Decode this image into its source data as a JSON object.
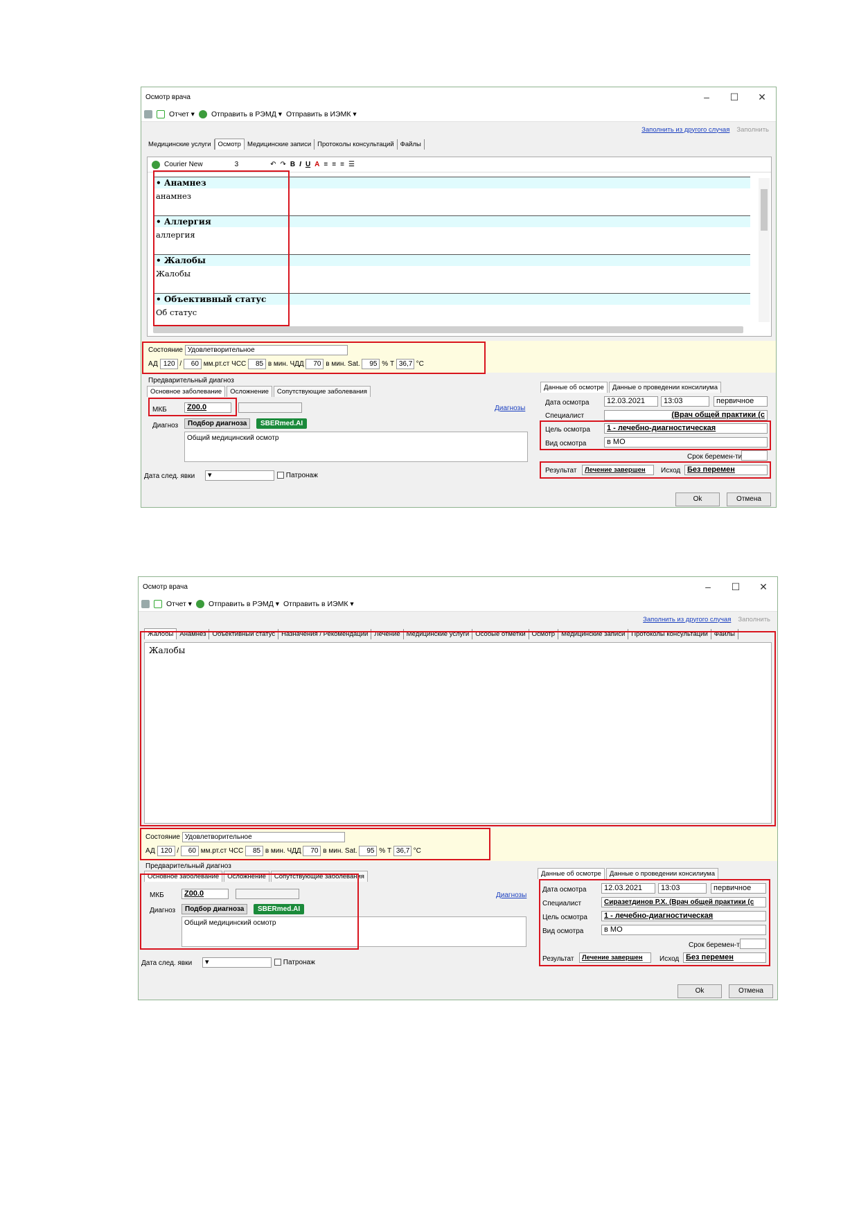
{
  "window1": {
    "title": "Осмотр врача",
    "toolbar": {
      "report": "Отчет ▾",
      "send_remd": "Отправить в РЭМД ▾",
      "send_iemk": "Отправить в ИЭМК ▾"
    },
    "fill_link": "Заполнить из другого случая",
    "fill_btn": "Заполнить",
    "tabs": [
      "Медицинские услуги",
      "Осмотр",
      "Медицинские записи",
      "Протоколы консультаций",
      "Файлы"
    ],
    "editor": {
      "font": "Courier New",
      "size": "3"
    },
    "sections": [
      {
        "title": "• Анамнез",
        "text": "анамнез"
      },
      {
        "title": "• Аллергия",
        "text": "аллергия"
      },
      {
        "title": "• Жалобы",
        "text": "Жалобы"
      },
      {
        "title": "• Объективный статус",
        "text": "Об статус"
      }
    ]
  },
  "window2": {
    "title": "Осмотр врача",
    "tabs": [
      "Жалобы",
      "Анамнез",
      "Объективный статус",
      "Назначения / Рекомендации",
      "Лечение",
      "Медицинские услуги",
      "Особые отметки",
      "Осмотр",
      "Медицинские записи",
      "Протоколы консультаций",
      "Файлы"
    ],
    "text": "Жалобы"
  },
  "vitals": {
    "state_label": "Состояние",
    "state": "Удовлетворительное",
    "ad_label": "АД",
    "ad_sys": "120",
    "ad_dia": "60",
    "ad_unit": "мм.рт.ст",
    "hr_label": "ЧСС",
    "hr": "85",
    "per_min": "в мин.",
    "rr_label": "ЧДД",
    "rr": "70",
    "sat_label": "Sat.",
    "sat": "95",
    "pct": "%",
    "t_label": "Т",
    "t": "36,7",
    "t_unit": "°С"
  },
  "diag": {
    "caption": "Предварительный диагноз",
    "tabs": [
      "Основное заболевание",
      "Осложнение",
      "Сопутствующие заболевания"
    ],
    "mkb_label": "МКБ",
    "mkb": "Z00.0",
    "diag_link": "Диагнозы",
    "diag_label": "Диагноз",
    "pick": "Подбор диагноза",
    "sber": "SBERmed.AI",
    "text": "Общий медицинский осмотр",
    "next_label": "Дата след. явки",
    "patronage": "Патронаж"
  },
  "exam": {
    "tabs": [
      "Данные об осмотре",
      "Данные о проведении консилиума"
    ],
    "date_label": "Дата осмотра",
    "date": "12.03.2021",
    "time": "13:03",
    "kind": "первичное",
    "spec_label": "Специалист",
    "spec1": "(Врач общей практики (с",
    "spec2": "Сиразетдинов Р.Х. (Врач общей практики (с",
    "goal_label": "Цель осмотра",
    "goal": "1 - лечебно-диагностическая",
    "type_label": "Вид осмотра",
    "type": "в МО",
    "preg_label": "Срок беремен-ти",
    "result_label": "Результат",
    "result": "Лечение завершен",
    "outcome_label": "Исход",
    "outcome": "Без перемен"
  },
  "buttons": {
    "ok": "Ok",
    "cancel": "Отмена"
  }
}
